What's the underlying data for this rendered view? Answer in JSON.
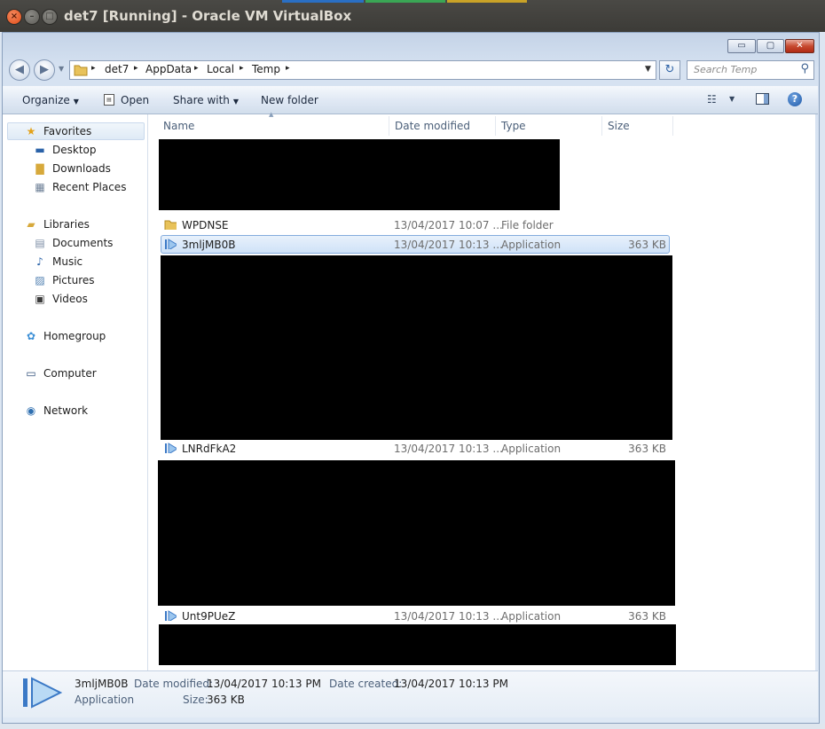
{
  "window": {
    "title": "det7 [Running] - Oracle VM VirtualBox",
    "close_glyph": "×",
    "min_glyph": "–",
    "max_glyph": "□"
  },
  "explorer_controls": {
    "min_glyph": "▭",
    "max_glyph": "▢",
    "close_glyph": "✕"
  },
  "navigation": {
    "back_glyph": "◀",
    "forward_glyph": "▶",
    "dropdown_glyph": "▼",
    "breadcrumbs": [
      "det7",
      "AppData",
      "Local",
      "Temp"
    ],
    "sep_glyph": "▸",
    "refresh_glyph": "↻",
    "search_placeholder": "Search Temp",
    "search_glyph": "⚲"
  },
  "toolbar": {
    "organize": "Organize",
    "open": "Open",
    "share_with": "Share with",
    "new_folder": "New folder",
    "arrow": "▼",
    "views_glyph": "☷",
    "help_glyph": "?"
  },
  "sidebar": {
    "favorites": "Favorites",
    "desktop": "Desktop",
    "downloads": "Downloads",
    "recent_places": "Recent Places",
    "libraries": "Libraries",
    "documents": "Documents",
    "music": "Music",
    "pictures": "Pictures",
    "videos": "Videos",
    "homegroup": "Homegroup",
    "computer": "Computer",
    "network": "Network"
  },
  "columns": {
    "name": "Name",
    "date_modified": "Date modified",
    "type": "Type",
    "size": "Size"
  },
  "files": [
    {
      "name": "WPDNSE",
      "date": "13/04/2017 10:07 ...",
      "type": "File folder",
      "size": ""
    },
    {
      "name": "3mljMB0B",
      "date": "13/04/2017 10:13 ...",
      "type": "Application",
      "size": "363 KB"
    },
    {
      "name": "LNRdFkA2",
      "date": "13/04/2017 10:13 ...",
      "type": "Application",
      "size": "363 KB"
    },
    {
      "name": "Unt9PUeZ",
      "date": "13/04/2017 10:13 ...",
      "type": "Application",
      "size": "363 KB"
    }
  ],
  "details": {
    "name": "3mljMB0B",
    "type": "Application",
    "date_modified_label": "Date modified:",
    "date_modified": "13/04/2017 10:13 PM",
    "date_created_label": "Date created:",
    "date_created": "13/04/2017 10:13 PM",
    "size_label": "Size:",
    "size": "363 KB"
  },
  "colors": {
    "selection_border": "#84acdd",
    "ubuntu_close": "#df4b16",
    "redaction": "#000000"
  }
}
